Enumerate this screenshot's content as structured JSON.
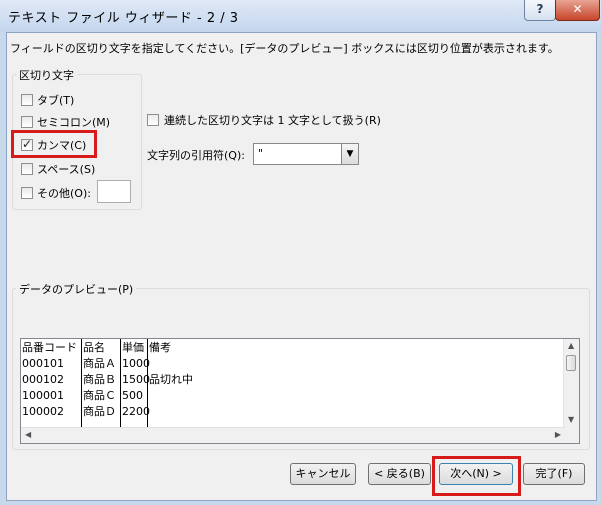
{
  "window": {
    "title": "テキスト ファイル ウィザード - 2 / 3",
    "help_label": "?",
    "close_label": "✕"
  },
  "instruction": "フィールドの区切り文字を指定してください。[データのプレビュー] ボックスには区切り位置が表示されます。",
  "delimiters": {
    "group_label": "区切り文字",
    "tab": {
      "label": "タブ(T)",
      "checked": false
    },
    "semicolon": {
      "label": "セミコロン(M)",
      "checked": false
    },
    "comma": {
      "label": "カンマ(C)",
      "checked": true
    },
    "space": {
      "label": "スペース(S)",
      "checked": false
    },
    "other": {
      "label": "その他(O):",
      "checked": false,
      "value": ""
    }
  },
  "options": {
    "consecutive_label": "連続した区切り文字は 1 文字として扱う(R)",
    "consecutive_checked": false,
    "qualifier_label": "文字列の引用符(Q):",
    "qualifier_value": "\""
  },
  "preview": {
    "group_label": "データのプレビュー(P)",
    "rows": [
      [
        "品番コード",
        "品名",
        "単価",
        "備考"
      ],
      [
        "000101",
        "商品Ａ",
        "1000",
        ""
      ],
      [
        "000102",
        "商品Ｂ",
        "1500",
        "品切れ中"
      ],
      [
        "100001",
        "商品Ｃ",
        "500",
        ""
      ],
      [
        "100002",
        "商品Ｄ",
        "2200",
        ""
      ]
    ]
  },
  "buttons": {
    "cancel": "キャンセル",
    "back": "< 戻る(B)",
    "next": "次へ(N) >",
    "finish": "完了(F)"
  },
  "highlight_color": "#d71a1a"
}
